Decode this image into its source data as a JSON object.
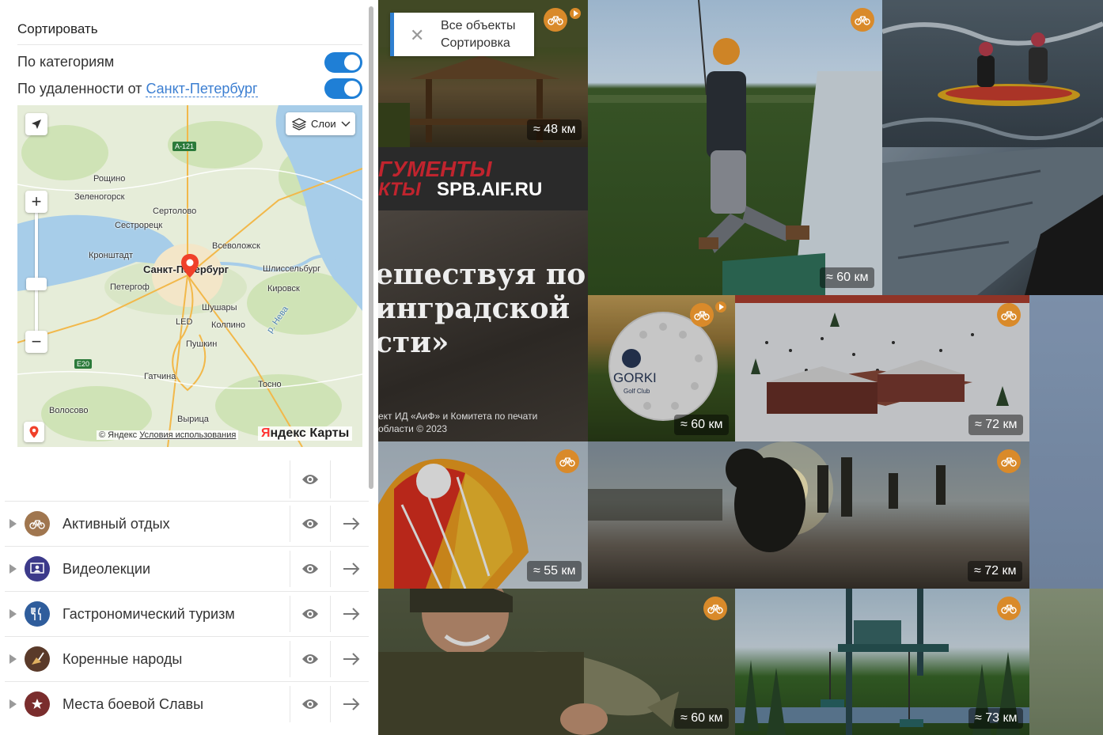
{
  "sort": {
    "title": "Сортировать",
    "by_category_label": "По категориям",
    "by_distance_label": "По удаленности от",
    "city": "Санкт-Петербург",
    "by_category_on": true,
    "by_distance_on": true
  },
  "map": {
    "layers_label": "Слои",
    "labels": {
      "spb": "Санкт-Петербург",
      "roshchino": "Рощино",
      "zelenogorsk": "Зеленогорск",
      "sertolovo": "Сертолово",
      "sestroretsk": "Сестрорецк",
      "vsevolozhsk": "Всеволожск",
      "kronshtadt": "Кронштадт",
      "shlisselburg": "Шлиссельбург",
      "petergof": "Петергоф",
      "kirovsk": "Кировск",
      "shushary": "Шушары",
      "kolpino": "Колпино",
      "pushkin": "Пушкин",
      "gatchina": "Гатчина",
      "tosno": "Тосно",
      "volosovo": "Волосово",
      "vyritsa": "Вырица",
      "neva": "р. Нева",
      "led": "LED",
      "a121": "А-121",
      "e20": "E20"
    },
    "copyright": "© Яндекс",
    "terms": "Условия использования",
    "brand_y": "Я",
    "brand_rest": "ндекс Карты"
  },
  "categories": [
    {
      "label": "Активный отдых",
      "color": "#a0764f",
      "icon": "bicycle-icon"
    },
    {
      "label": "Видеолекции",
      "color": "#3c3a8a",
      "icon": "video-lecture-icon"
    },
    {
      "label": "Гастрономический туризм",
      "color": "#2f5d9c",
      "icon": "cutlery-icon"
    },
    {
      "label": "Коренные народы",
      "color": "#5a3a2a",
      "icon": "balalaika-icon"
    },
    {
      "label": "Места боевой Славы",
      "color": "#7a2d2d",
      "icon": "star-wreath-icon"
    }
  ],
  "filter_chip": {
    "line1": "Все объекты",
    "line2": "Сортировка"
  },
  "ad": {
    "line_top_red": "ГУМЕНТЫ",
    "line_red2": "КТЫ",
    "site": "SPB.AIF.RU",
    "headline": "ешествуя по\nинградской\nсти»",
    "footer": "ект ИД «АиФ» и Комитета по печати\nобласти © 2023"
  },
  "tiles": [
    {
      "distance": "≈ 48 км"
    },
    {
      "distance": "≈ 60 км"
    },
    {
      "distance": "≈ 60 км"
    },
    {
      "distance": "≈ 72 км"
    },
    {
      "distance": "≈ 55 км"
    },
    {
      "distance": "≈ 72 км"
    },
    {
      "distance": "≈ 60 км"
    },
    {
      "distance": "≈ 73 км"
    }
  ],
  "colors": {
    "accent": "#1f7fd6",
    "badge": "#d98a2a",
    "link": "#3b7ed1"
  }
}
